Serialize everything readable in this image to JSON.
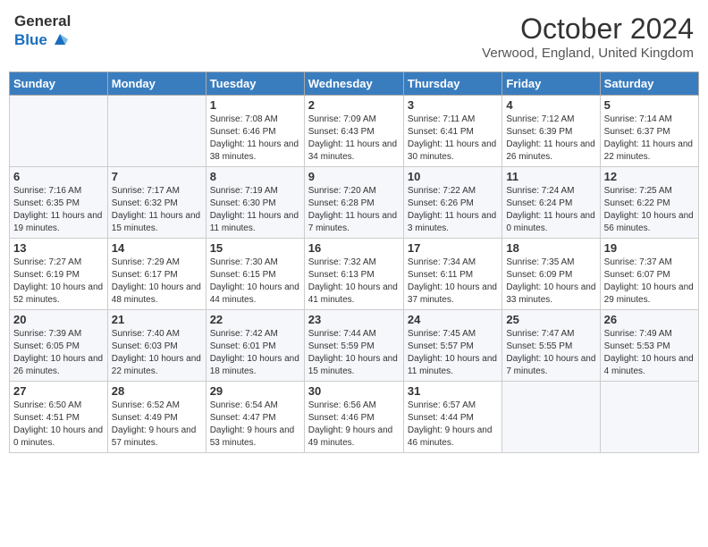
{
  "header": {
    "logo_line1": "General",
    "logo_line2": "Blue",
    "month": "October 2024",
    "location": "Verwood, England, United Kingdom"
  },
  "days_of_week": [
    "Sunday",
    "Monday",
    "Tuesday",
    "Wednesday",
    "Thursday",
    "Friday",
    "Saturday"
  ],
  "weeks": [
    [
      {
        "day": "",
        "detail": ""
      },
      {
        "day": "",
        "detail": ""
      },
      {
        "day": "1",
        "detail": "Sunrise: 7:08 AM\nSunset: 6:46 PM\nDaylight: 11 hours and 38 minutes."
      },
      {
        "day": "2",
        "detail": "Sunrise: 7:09 AM\nSunset: 6:43 PM\nDaylight: 11 hours and 34 minutes."
      },
      {
        "day": "3",
        "detail": "Sunrise: 7:11 AM\nSunset: 6:41 PM\nDaylight: 11 hours and 30 minutes."
      },
      {
        "day": "4",
        "detail": "Sunrise: 7:12 AM\nSunset: 6:39 PM\nDaylight: 11 hours and 26 minutes."
      },
      {
        "day": "5",
        "detail": "Sunrise: 7:14 AM\nSunset: 6:37 PM\nDaylight: 11 hours and 22 minutes."
      }
    ],
    [
      {
        "day": "6",
        "detail": "Sunrise: 7:16 AM\nSunset: 6:35 PM\nDaylight: 11 hours and 19 minutes."
      },
      {
        "day": "7",
        "detail": "Sunrise: 7:17 AM\nSunset: 6:32 PM\nDaylight: 11 hours and 15 minutes."
      },
      {
        "day": "8",
        "detail": "Sunrise: 7:19 AM\nSunset: 6:30 PM\nDaylight: 11 hours and 11 minutes."
      },
      {
        "day": "9",
        "detail": "Sunrise: 7:20 AM\nSunset: 6:28 PM\nDaylight: 11 hours and 7 minutes."
      },
      {
        "day": "10",
        "detail": "Sunrise: 7:22 AM\nSunset: 6:26 PM\nDaylight: 11 hours and 3 minutes."
      },
      {
        "day": "11",
        "detail": "Sunrise: 7:24 AM\nSunset: 6:24 PM\nDaylight: 11 hours and 0 minutes."
      },
      {
        "day": "12",
        "detail": "Sunrise: 7:25 AM\nSunset: 6:22 PM\nDaylight: 10 hours and 56 minutes."
      }
    ],
    [
      {
        "day": "13",
        "detail": "Sunrise: 7:27 AM\nSunset: 6:19 PM\nDaylight: 10 hours and 52 minutes."
      },
      {
        "day": "14",
        "detail": "Sunrise: 7:29 AM\nSunset: 6:17 PM\nDaylight: 10 hours and 48 minutes."
      },
      {
        "day": "15",
        "detail": "Sunrise: 7:30 AM\nSunset: 6:15 PM\nDaylight: 10 hours and 44 minutes."
      },
      {
        "day": "16",
        "detail": "Sunrise: 7:32 AM\nSunset: 6:13 PM\nDaylight: 10 hours and 41 minutes."
      },
      {
        "day": "17",
        "detail": "Sunrise: 7:34 AM\nSunset: 6:11 PM\nDaylight: 10 hours and 37 minutes."
      },
      {
        "day": "18",
        "detail": "Sunrise: 7:35 AM\nSunset: 6:09 PM\nDaylight: 10 hours and 33 minutes."
      },
      {
        "day": "19",
        "detail": "Sunrise: 7:37 AM\nSunset: 6:07 PM\nDaylight: 10 hours and 29 minutes."
      }
    ],
    [
      {
        "day": "20",
        "detail": "Sunrise: 7:39 AM\nSunset: 6:05 PM\nDaylight: 10 hours and 26 minutes."
      },
      {
        "day": "21",
        "detail": "Sunrise: 7:40 AM\nSunset: 6:03 PM\nDaylight: 10 hours and 22 minutes."
      },
      {
        "day": "22",
        "detail": "Sunrise: 7:42 AM\nSunset: 6:01 PM\nDaylight: 10 hours and 18 minutes."
      },
      {
        "day": "23",
        "detail": "Sunrise: 7:44 AM\nSunset: 5:59 PM\nDaylight: 10 hours and 15 minutes."
      },
      {
        "day": "24",
        "detail": "Sunrise: 7:45 AM\nSunset: 5:57 PM\nDaylight: 10 hours and 11 minutes."
      },
      {
        "day": "25",
        "detail": "Sunrise: 7:47 AM\nSunset: 5:55 PM\nDaylight: 10 hours and 7 minutes."
      },
      {
        "day": "26",
        "detail": "Sunrise: 7:49 AM\nSunset: 5:53 PM\nDaylight: 10 hours and 4 minutes."
      }
    ],
    [
      {
        "day": "27",
        "detail": "Sunrise: 6:50 AM\nSunset: 4:51 PM\nDaylight: 10 hours and 0 minutes."
      },
      {
        "day": "28",
        "detail": "Sunrise: 6:52 AM\nSunset: 4:49 PM\nDaylight: 9 hours and 57 minutes."
      },
      {
        "day": "29",
        "detail": "Sunrise: 6:54 AM\nSunset: 4:47 PM\nDaylight: 9 hours and 53 minutes."
      },
      {
        "day": "30",
        "detail": "Sunrise: 6:56 AM\nSunset: 4:46 PM\nDaylight: 9 hours and 49 minutes."
      },
      {
        "day": "31",
        "detail": "Sunrise: 6:57 AM\nSunset: 4:44 PM\nDaylight: 9 hours and 46 minutes."
      },
      {
        "day": "",
        "detail": ""
      },
      {
        "day": "",
        "detail": ""
      }
    ]
  ]
}
